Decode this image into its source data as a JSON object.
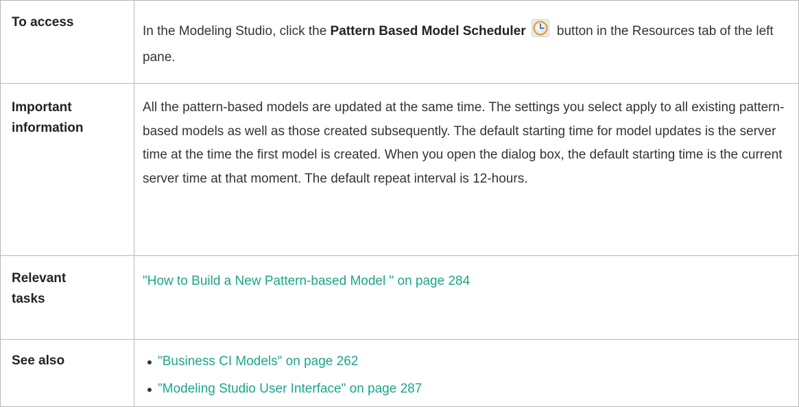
{
  "rows": [
    {
      "label": "To access",
      "text_before": "In the Modeling Studio, click the ",
      "bold_text": "Pattern Based Model Scheduler",
      "icon": "clock-icon",
      "text_after": " button in the Resources tab of the left pane."
    },
    {
      "label_line1": "Important",
      "label_line2": "information",
      "text": "All the pattern-based models are updated at the same time. The settings you select apply to all existing pattern-based models as well as those created subsequently. The default starting time for model updates is the server time at the time the first model is created. When you open the dialog box, the default starting time is the current server time at that moment. The default repeat interval is 12-hours."
    },
    {
      "label_line1": "Relevant",
      "label_line2": "tasks",
      "link": "\"How to Build a New Pattern-based Model \" on page 284"
    },
    {
      "label": "See also",
      "links": [
        "\"Business CI Models\" on page 262",
        "\"Modeling Studio User Interface\" on page 287"
      ]
    }
  ],
  "colors": {
    "link": "#1aa58a",
    "text": "#333333",
    "border": "#b7b7b7",
    "icon_ring": "#f0a020",
    "icon_face": "#3a6fd0"
  }
}
